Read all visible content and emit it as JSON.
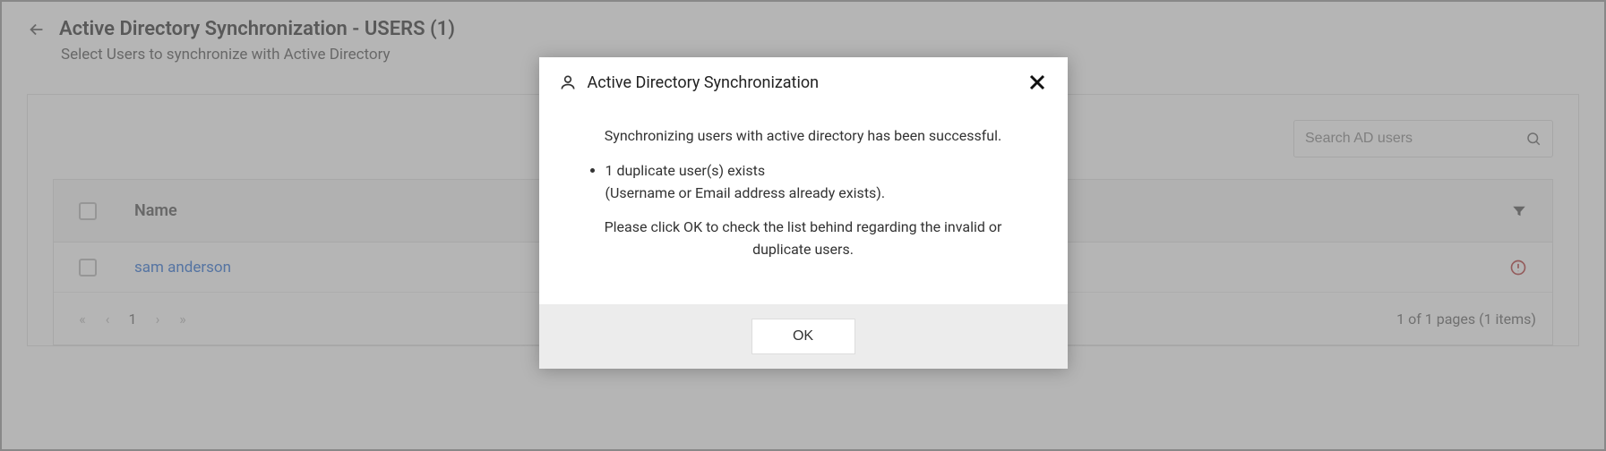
{
  "header": {
    "title": "Active Directory Synchronization - USERS (1)",
    "subtitle": "Select Users to synchronize with Active Directory"
  },
  "search": {
    "placeholder": "Search AD users"
  },
  "table": {
    "col_name": "Name",
    "rows": [
      {
        "name": "sam anderson"
      }
    ]
  },
  "pager": {
    "first": "«",
    "prev": "‹",
    "page": "1",
    "next": "›",
    "last": "»",
    "summary": "1 of 1 pages (1 items)"
  },
  "modal": {
    "title": "Active Directory Synchronization",
    "msg_success": "Synchronizing users with active directory has been successful.",
    "bullet_main": "1 duplicate user(s) exists",
    "bullet_sub": "(Username or Email address already exists).",
    "msg_action": "Please click OK to check the list behind regarding the invalid or duplicate users.",
    "ok": "OK"
  }
}
